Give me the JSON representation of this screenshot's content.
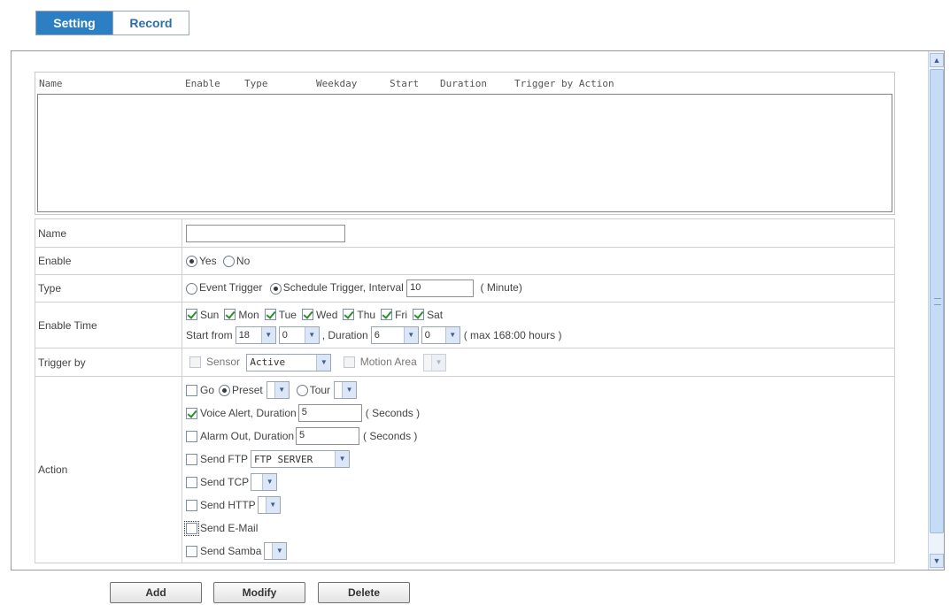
{
  "tabs": [
    {
      "label": "Setting",
      "active": true
    },
    {
      "label": "Record",
      "active": false
    }
  ],
  "list": {
    "columns": [
      "Name",
      "Enable",
      "Type",
      "Weekday",
      "Start",
      "Duration",
      "Trigger by Action"
    ],
    "rows": []
  },
  "form": {
    "name": {
      "label": "Name",
      "value": ""
    },
    "enable": {
      "label": "Enable",
      "options": [
        "Yes",
        "No"
      ],
      "selected": "Yes"
    },
    "type": {
      "label": "Type",
      "event_label": "Event Trigger",
      "schedule_label": "Schedule Trigger, Interval",
      "selected": "Schedule Trigger",
      "interval": "10",
      "unit": "( Minute)"
    },
    "enable_time": {
      "label": "Enable Time",
      "days": [
        {
          "label": "Sun",
          "checked": true
        },
        {
          "label": "Mon",
          "checked": true
        },
        {
          "label": "Tue",
          "checked": true
        },
        {
          "label": "Wed",
          "checked": true
        },
        {
          "label": "Thu",
          "checked": true
        },
        {
          "label": "Fri",
          "checked": true
        },
        {
          "label": "Sat",
          "checked": true
        }
      ],
      "start_from_label": "Start from",
      "start_hour": "18",
      "start_minute": "0",
      "duration_label": ", Duration",
      "duration_hour": "6",
      "duration_minute": "0",
      "max_label": "( max 168:00 hours )"
    },
    "trigger_by": {
      "label": "Trigger by",
      "sensor_label": "Sensor",
      "sensor_value": "Active",
      "motion_label": "Motion Area",
      "motion_value": ""
    },
    "action": {
      "label": "Action",
      "go_label": "Go",
      "preset_label": "Preset",
      "tour_label": "Tour",
      "go_mode": "Preset",
      "voice_label": "Voice Alert, Duration",
      "voice_duration": "5",
      "voice_unit": "( Seconds )",
      "alarm_label": "Alarm Out, Duration",
      "alarm_duration": "5",
      "alarm_unit": "( Seconds )",
      "ftp_label": "Send FTP",
      "ftp_value": "FTP SERVER",
      "tcp_label": "Send TCP",
      "http_label": "Send HTTP",
      "email_label": "Send E-Mail",
      "samba_label": "Send Samba",
      "checked": {
        "go": false,
        "voice": true,
        "alarm": false,
        "ftp": false,
        "tcp": false,
        "http": false,
        "email": false,
        "samba": false
      }
    }
  },
  "buttons": {
    "add": "Add",
    "modify": "Modify",
    "delete": "Delete"
  },
  "colors": {
    "tab_active": "#2c7fc2",
    "check": "#2e8b2e",
    "scrollbar": "#c6dbf5"
  },
  "icons": {
    "dropdown": "chevron-down-icon",
    "scroll_up": "arrow-up-icon",
    "scroll_down": "arrow-down-icon"
  }
}
